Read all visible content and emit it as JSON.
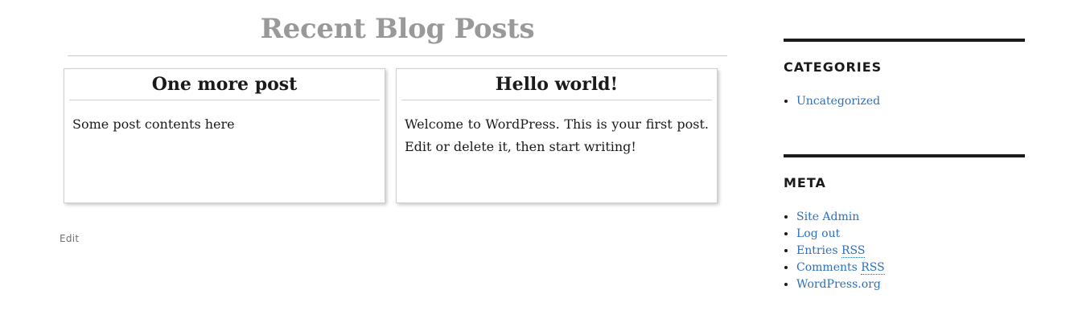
{
  "main": {
    "page_title": "Recent Blog Posts",
    "posts": [
      {
        "title": "One more post",
        "content": "Some post contents here"
      },
      {
        "title": "Hello world!",
        "content": "Welcome to WordPress. This is your first post. Edit or delete it, then start writing!"
      }
    ],
    "edit_label": "Edit"
  },
  "sidebar": {
    "categories": {
      "title": "CATEGORIES",
      "items": [
        {
          "label": "Uncategorized"
        }
      ]
    },
    "meta": {
      "title": "META",
      "items": [
        {
          "label": "Site Admin"
        },
        {
          "label": "Log out"
        },
        {
          "prefix": "Entries",
          "abbr": "RSS"
        },
        {
          "prefix": "Comments",
          "abbr": "RSS"
        },
        {
          "label": "WordPress.org"
        }
      ]
    }
  },
  "colors": {
    "title_gray": "#999999",
    "link_blue": "#2c6fbb",
    "rule_dark": "#1a1a1a",
    "edit_gray": "#707070"
  }
}
